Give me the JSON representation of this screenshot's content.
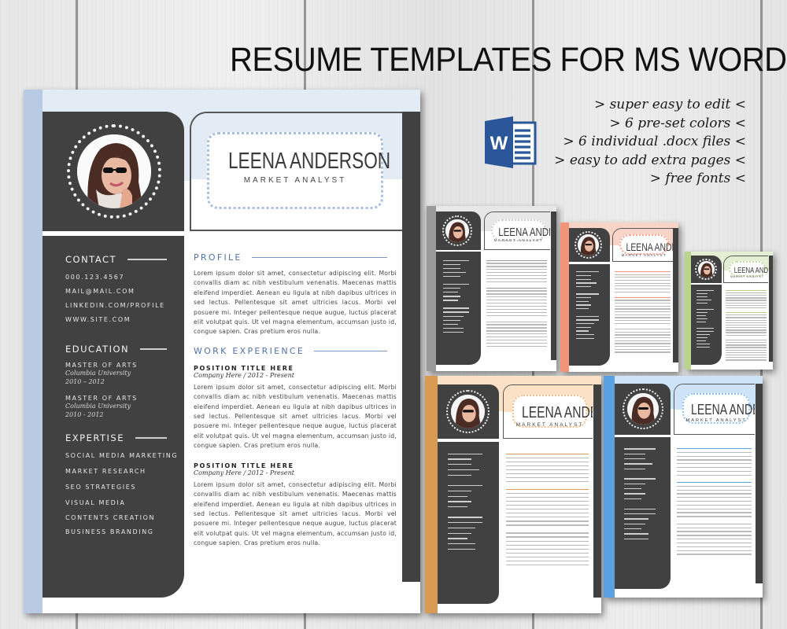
{
  "headline": "RESUME TEMPLATES FOR MS WORD",
  "features": [
    "> super easy to edit <",
    "> 6 pre-set colors  <",
    "> 6 individual .docx files <",
    "> easy to add extra pages <",
    "> free fonts <"
  ],
  "icons": {
    "word": "ms-word-icon",
    "word_letter": "W"
  },
  "colors": {
    "sidebar_dark": "#414141",
    "accent_blue": "#4f73a8",
    "variant_gray": "#9a9a9a",
    "variant_salmon": "#f3957a",
    "variant_green": "#b9d48c",
    "variant_orange": "#d99a54",
    "variant_blue": "#5aa1e3",
    "word_blue": "#2b579a"
  },
  "resume": {
    "name": "LEENA ANDERSON",
    "title": "MARKET ANALYST",
    "contact": {
      "heading": "CONTACT",
      "items": [
        "000.123.4567",
        "MAIL@MAIL.COM",
        "LINKEDIN.COM/PROFILE",
        "WWW.SITE.COM"
      ]
    },
    "education": {
      "heading": "EDUCATION",
      "items": [
        {
          "degree": "MASTER OF ARTS",
          "school": "Columbia  University",
          "years": "2010 – 2012"
        },
        {
          "degree": "MASTER OF ARTS",
          "school": "Columbia  University",
          "years": "2010 - 2012"
        }
      ]
    },
    "expertise": {
      "heading": "EXPERTISE",
      "items": [
        "SOCIAL MEDIA MARKETING",
        "MARKET RESEARCH",
        "SEO STRATEGIES",
        "VISUAL MEDIA",
        "CONTENTS CREATION",
        "BUSINESS BRANDING"
      ]
    },
    "profile": {
      "heading": "PROFILE",
      "text": "Lorem ipsum dolor sit amet, consectetur adipiscing elit. Morbi convallis diam ac nibh vestibulum venenatis. Maecenas mattis eleifend imperdiet. Aenean eu ligula at nibh dapibus ultrices in sed lectus. Pellentesque sit amet ultricies lacus. Morbi vel posuere mi. Integer pellentesque neque augue, luctus placerat elit volutpat quis. Ut vel magna elementum, accumsan justo id, congue sapien. Cras pretium eros nulla."
    },
    "work": {
      "heading": "WORK EXPERIENCE",
      "items": [
        {
          "position": "POSITION TITLE HERE",
          "company": "Company Here / 2012 - Present",
          "text": "Lorem ipsum dolor sit amet, consectetur adipiscing elit. Morbi convallis diam ac nibh vestibulum venenatis. Maecenas mattis eleifend imperdiet. Aenean eu ligula at nibh dapibus ultrices in sed lectus. Pellentesque sit amet ultricies lacus. Morbi vel posuere mi. Integer pellentesque neque augue, luctus placerat elit volutpat quis. Ut vel magna elementum, accumsan justo id, congue sapien. Cras pretium eros nulla."
        },
        {
          "position": "POSITION TITLE HERE",
          "company": "Company Here / 2012 - Present",
          "text": "Lorem ipsum dolor sit amet, consectetur adipiscing elit. Morbi convallis diam ac nibh vestibulum venenatis. Maecenas mattis eleifend imperdiet. Aenean eu ligula at nibh dapibus ultrices in sed lectus. Pellentesque sit amet ultricies lacus. Morbi vel posuere mi. Integer pellentesque neque augue, luctus placerat elit volutpat quis. Ut vel magna elementum, accumsan justo id, congue sapien. Cras pretium eros nulla."
        }
      ]
    }
  },
  "variants": [
    {
      "id": "gray",
      "name": "LEENA ANDERSON",
      "title": "MARKET ANALYST",
      "accent": "#9a9a9a",
      "tint": "#e7e7e7",
      "dots": "#cfcfcf"
    },
    {
      "id": "salmon",
      "name": "LEENA ANDERSON",
      "title": "MARKET ANALYST",
      "accent": "#f3957a",
      "tint": "#f8d3c8",
      "dots": "#f3a58f"
    },
    {
      "id": "green",
      "name": "LEENA ANDERSON",
      "title": "MARKET ANALYST",
      "accent": "#b9d48c",
      "tint": "#e3eed2",
      "dots": "#c6dba3"
    },
    {
      "id": "orange",
      "name": "LEENA ANDERSON",
      "title": "MARKET ANALYST",
      "accent": "#d99a54",
      "tint": "#fbe1c6",
      "dots": "#f2bd84"
    },
    {
      "id": "blue",
      "name": "LEENA ANDERSON",
      "title": "MARKET ANALYST",
      "accent": "#5aa1e3",
      "tint": "#cfe3f8",
      "dots": "#8ebfee"
    }
  ]
}
